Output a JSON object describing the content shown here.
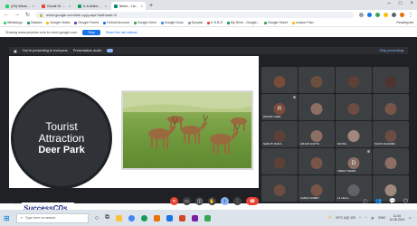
{
  "browser": {
    "tabs": [
      {
        "title": "(29) WhatsApp",
        "color": "#25d366",
        "active": false
      },
      {
        "title": "Gmail ID - Attending for 5...",
        "color": "#ea4335",
        "active": false
      },
      {
        "title": "II-A Attendance Sheets 2021 ...",
        "color": "#0f9d58",
        "active": false
      },
      {
        "title": "Meet – hsh-vyyy-aqe",
        "color": "#00897b",
        "active": true
      }
    ],
    "url": "meet.google.com/hsh-vyyy-aqe?authuser=0",
    "bookmarks": [
      "WhatsApp",
      "Classes",
      "Google Notes",
      "Google Forms",
      "Oxford Account",
      "Google Drive",
      "Google Docs",
      "Syncast",
      "K.S.B.S",
      "My Drive - Google...",
      "Google Sheet",
      "Lesson Plan",
      "Reading list"
    ],
    "banner": {
      "message": "Sharing www.youtube.com to meet.google.com",
      "button": "Stop",
      "link": "Share this tab instead"
    }
  },
  "meet": {
    "presenting_text": "You're presenting to everyone",
    "audio_label": "Presentation audio",
    "stop_label": "Stop presenting",
    "slide": {
      "title_line1": "Tourist",
      "title_line2": "Attraction",
      "title_line3": "Deer Park",
      "logo": "SuccessCDs"
    },
    "participants": [
      {
        "name": "",
        "initial": "",
        "color": "#7a4a3a"
      },
      {
        "name": "",
        "initial": "",
        "color": "#6b4e3d"
      },
      {
        "name": "",
        "initial": "",
        "color": "#5d4037"
      },
      {
        "name": "",
        "initial": "",
        "color": "#4e342e"
      },
      {
        "name": "RONAK GOEL",
        "initial": "R",
        "color": "#7a4a3a"
      },
      {
        "name": "",
        "initial": "",
        "color": "#8d6e63"
      },
      {
        "name": "",
        "initial": "",
        "color": "#6d4c41"
      },
      {
        "name": "",
        "initial": "",
        "color": "#795548"
      },
      {
        "name": "SHRUTI RANA",
        "initial": "S",
        "color": "#5d4037"
      },
      {
        "name": "ARJUN GUPTA",
        "initial": "A",
        "color": "#8d6e63"
      },
      {
        "name": "NAYRA",
        "initial": "N",
        "color": "#a1887f"
      },
      {
        "name": "KAVYA SHARMA",
        "initial": "K",
        "color": "#6d4c41"
      },
      {
        "name": "",
        "initial": "",
        "color": "#5d4037"
      },
      {
        "name": "",
        "initial": "",
        "color": "#795548"
      },
      {
        "name": "VIBHU TIWARI",
        "initial": "D",
        "color": "#3c4043"
      },
      {
        "name": "",
        "initial": "",
        "color": "#8d6e63"
      },
      {
        "name": "",
        "initial": "",
        "color": "#6d4c41"
      },
      {
        "name": "AARAV DUBEY",
        "initial": "A",
        "color": "#795548"
      },
      {
        "name": "14 others",
        "initial": "",
        "color": "#3c4043"
      },
      {
        "name": "",
        "initial": "",
        "color": "#a1887f"
      }
    ],
    "time": "11:34 AM | dhkgefurl"
  },
  "taskbar": {
    "search_placeholder": "Type here to search",
    "weather": "29°C  AQI 152",
    "clock_time": "11:34",
    "clock_date": "10-08-2021",
    "lang": "ENG"
  }
}
